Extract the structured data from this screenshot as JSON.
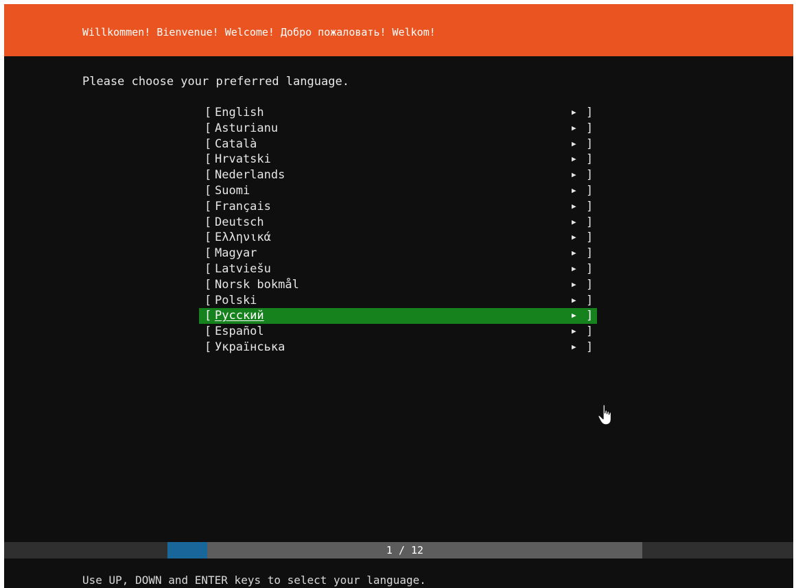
{
  "colors": {
    "header_bg": "#e95420",
    "screen_bg": "#0f0f0f",
    "selected_bg": "#15821e",
    "progress_track": "#5d5d5d",
    "progress_fill": "#19679a",
    "footer_bar": "#2f2f2f"
  },
  "header": {
    "title": "Willkommen! Bienvenue! Welcome! Добро пожаловать! Welkom!"
  },
  "prompt": "Please choose your preferred language.",
  "languages": {
    "selected_index": 13,
    "bracket_left": "[",
    "bracket_right": "]",
    "arrow_glyph": "▶",
    "items": [
      {
        "label": "English"
      },
      {
        "label": "Asturianu"
      },
      {
        "label": "Català"
      },
      {
        "label": "Hrvatski"
      },
      {
        "label": "Nederlands"
      },
      {
        "label": "Suomi"
      },
      {
        "label": "Français"
      },
      {
        "label": "Deutsch"
      },
      {
        "label": "Ελληνικά"
      },
      {
        "label": "Magyar"
      },
      {
        "label": "Latviešu"
      },
      {
        "label": "Norsk bokmål"
      },
      {
        "label": "Polski"
      },
      {
        "label": "Русский"
      },
      {
        "label": "Español"
      },
      {
        "label": "Українська"
      }
    ]
  },
  "cursor_icon": "hand-pointer-icon",
  "progress": {
    "label": "1 / 12",
    "current": 1,
    "total": 12
  },
  "footer": {
    "help": "Use UP, DOWN and ENTER keys to select your language."
  }
}
